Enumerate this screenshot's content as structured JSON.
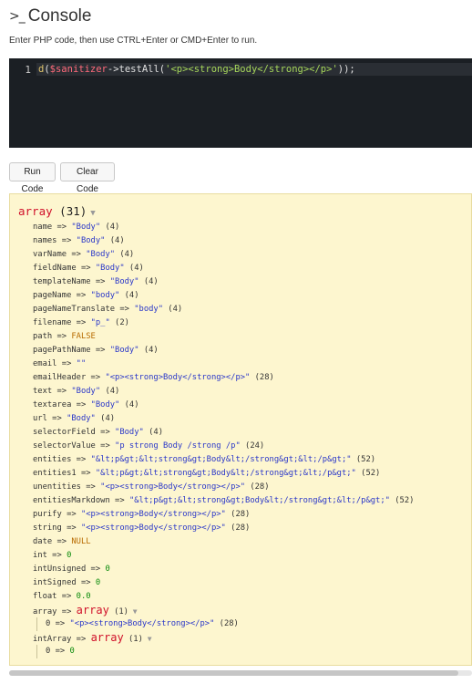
{
  "header": {
    "icon": ">_",
    "title": "Console"
  },
  "subtitle": "Enter PHP code, then use CTRL+Enter or CMD+Enter to run.",
  "editor": {
    "line_number": "1",
    "code": {
      "fn": "d",
      "open": "(",
      "var": "$sanitizer",
      "arrow": "->",
      "method": "testAll",
      "paren_open": "(",
      "str": "'<p><strong>Body</strong></p>'",
      "close": "));"
    }
  },
  "buttons": {
    "run": "Run Code",
    "clear": "Clear Code"
  },
  "output": {
    "head_kw": "array",
    "head_count": " (31)",
    "rows": [
      {
        "key": "name",
        "val": "\"Body\"",
        "type": "s",
        "count": " (4)"
      },
      {
        "key": "names",
        "val": "\"Body\"",
        "type": "s",
        "count": " (4)"
      },
      {
        "key": "varName",
        "val": "\"Body\"",
        "type": "s",
        "count": " (4)"
      },
      {
        "key": "fieldName",
        "val": "\"Body\"",
        "type": "s",
        "count": " (4)"
      },
      {
        "key": "templateName",
        "val": "\"Body\"",
        "type": "s",
        "count": " (4)"
      },
      {
        "key": "pageName",
        "val": "\"body\"",
        "type": "s",
        "count": " (4)"
      },
      {
        "key": "pageNameTranslate",
        "val": "\"body\"",
        "type": "s",
        "count": " (4)"
      },
      {
        "key": "filename",
        "val": "\"p_\"",
        "type": "s",
        "count": " (2)"
      },
      {
        "key": "path",
        "val": "FALSE",
        "type": "lit",
        "count": ""
      },
      {
        "key": "pagePathName",
        "val": "\"Body\"",
        "type": "s",
        "count": " (4)"
      },
      {
        "key": "email",
        "val": "\"\"",
        "type": "s",
        "count": ""
      },
      {
        "key": "emailHeader",
        "val": "\"<p><strong>Body</strong></p>\"",
        "type": "s",
        "count": " (28)"
      },
      {
        "key": "text",
        "val": "\"Body\"",
        "type": "s",
        "count": " (4)"
      },
      {
        "key": "textarea",
        "val": "\"Body\"",
        "type": "s",
        "count": " (4)"
      },
      {
        "key": "url",
        "val": "\"Body\"",
        "type": "s",
        "count": " (4)"
      },
      {
        "key": "selectorField",
        "val": "\"Body\"",
        "type": "s",
        "count": " (4)"
      },
      {
        "key": "selectorValue",
        "val": "\"p strong Body /strong /p\"",
        "type": "s",
        "count": " (24)"
      },
      {
        "key": "entities",
        "val": "\"&lt;p&gt;&lt;strong&gt;Body&lt;/strong&gt;&lt;/p&gt;\"",
        "type": "s",
        "count": " (52)"
      },
      {
        "key": "entities1",
        "val": "\"&lt;p&gt;&lt;strong&gt;Body&lt;/strong&gt;&lt;/p&gt;\"",
        "type": "s",
        "count": " (52)"
      },
      {
        "key": "unentities",
        "val": "\"<p><strong>Body</strong></p>\"",
        "type": "s",
        "count": " (28)"
      },
      {
        "key": "entitiesMarkdown",
        "val": "\"&lt;p&gt;&lt;strong&gt;Body&lt;/strong&gt;&lt;/p&gt;\"",
        "type": "s",
        "count": " (52)"
      },
      {
        "key": "purify",
        "val": "\"<p><strong>Body</strong></p>\"",
        "type": "s",
        "count": " (28)"
      },
      {
        "key": "string",
        "val": "\"<p><strong>Body</strong></p>\"",
        "type": "s",
        "count": " (28)"
      },
      {
        "key": "date",
        "val": "NULL",
        "type": "lit",
        "count": ""
      },
      {
        "key": "int",
        "val": "0",
        "type": "num",
        "count": ""
      },
      {
        "key": "intUnsigned",
        "val": "0",
        "type": "num",
        "count": ""
      },
      {
        "key": "intSigned",
        "val": "0",
        "type": "num",
        "count": ""
      },
      {
        "key": "float",
        "val": "0.0",
        "type": "num",
        "count": ""
      }
    ],
    "array_row": {
      "key": "array",
      "kw": "array",
      "count": " (1)"
    },
    "array_child": {
      "key": "0",
      "val": "\"<p><strong>Body</strong></p>\"",
      "count": " (28)"
    },
    "intarray_row": {
      "key": "intArray",
      "kw": "array",
      "count": " (1)"
    },
    "intarray_child": {
      "key": "0",
      "val": "0"
    }
  },
  "scrollbar": {
    "fraction": 0.97
  },
  "colors": {
    "output_bg": "#fdf6cf",
    "editor_bg": "#1b1f24",
    "string": "#2a37c9",
    "keyword": "#d0102a"
  }
}
